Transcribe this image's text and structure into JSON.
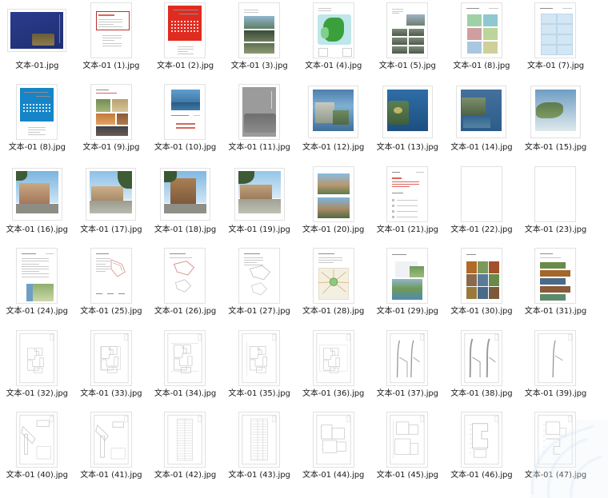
{
  "window": {
    "background_color": "#ffffff",
    "columns": 8,
    "rows": 6,
    "total_items": 48
  },
  "watermark": {
    "name": "corner-watermark",
    "color": "#cfe0ef",
    "visible": true
  },
  "files": [
    {
      "label": "文本-01.jpg",
      "kind": "cover-blue-landscape",
      "orient": "landscape"
    },
    {
      "label": "文本-01 (1).jpg",
      "kind": "doc-red-frame",
      "orient": "portrait"
    },
    {
      "label": "文本-01 (2).jpg",
      "kind": "cover-red",
      "orient": "portrait"
    },
    {
      "label": "文本-01 (3).jpg",
      "kind": "doc-photo-strip",
      "orient": "portrait"
    },
    {
      "label": "文本-01 (4).jpg",
      "kind": "map-green",
      "orient": "portrait"
    },
    {
      "label": "文本-01 (5).jpg",
      "kind": "doc-photo-grid-gray",
      "orient": "portrait"
    },
    {
      "label": "文本-01 (8).jpg",
      "kind": "doc-analysis-4up",
      "orient": "portrait"
    },
    {
      "label": "文本-01 (7).jpg",
      "kind": "doc-analysis-blue",
      "orient": "portrait"
    },
    {
      "label": "文本-01 (8).jpg",
      "kind": "cover-cyan",
      "orient": "portrait"
    },
    {
      "label": "文本-01 (9).jpg",
      "kind": "doc-collage-warm",
      "orient": "portrait"
    },
    {
      "label": "文本-01 (10).jpg",
      "kind": "doc-lake-photo",
      "orient": "portrait"
    },
    {
      "label": "文本-01 (11).jpg",
      "kind": "render-gray",
      "orient": "portrait"
    },
    {
      "label": "文本-01 (12).jpg",
      "kind": "render-aerial-city",
      "orient": "square"
    },
    {
      "label": "文本-01 (13).jpg",
      "kind": "render-aerial-bay",
      "orient": "square"
    },
    {
      "label": "文本-01 (14).jpg",
      "kind": "render-aerial-coast",
      "orient": "square"
    },
    {
      "label": "文本-01 (15).jpg",
      "kind": "render-aerial-river",
      "orient": "square"
    },
    {
      "label": "文本-01 (16).jpg",
      "kind": "render-villa-a",
      "orient": "square"
    },
    {
      "label": "文本-01 (17).jpg",
      "kind": "render-street-a",
      "orient": "square"
    },
    {
      "label": "文本-01 (18).jpg",
      "kind": "render-villa-b",
      "orient": "square"
    },
    {
      "label": "文本-01 (19).jpg",
      "kind": "render-street-b",
      "orient": "square"
    },
    {
      "label": "文本-01 (20).jpg",
      "kind": "render-two-up",
      "orient": "portrait"
    },
    {
      "label": "文本-01 (21).jpg",
      "kind": "doc-text-list",
      "orient": "portrait"
    },
    {
      "label": "文本-01 (22).jpg",
      "kind": "doc-photo-mosaic",
      "orient": "portrait"
    },
    {
      "label": "文本-01 (23).jpg",
      "kind": "cover-blue-page",
      "orient": "portrait"
    },
    {
      "label": "文本-01 (24).jpg",
      "kind": "doc-text-sitemap",
      "orient": "portrait"
    },
    {
      "label": "文本-01 (25).jpg",
      "kind": "doc-diagram-red",
      "orient": "portrait"
    },
    {
      "label": "文本-01 (26).jpg",
      "kind": "doc-diagram-red2",
      "orient": "portrait"
    },
    {
      "label": "文本-01 (27).jpg",
      "kind": "doc-diagram-gray",
      "orient": "portrait"
    },
    {
      "label": "文本-01 (28).jpg",
      "kind": "doc-radial-map",
      "orient": "portrait"
    },
    {
      "label": "文本-01 (29).jpg",
      "kind": "doc-landscape-plan",
      "orient": "portrait"
    },
    {
      "label": "文本-01 (30).jpg",
      "kind": "doc-mood-collage",
      "orient": "portrait"
    },
    {
      "label": "文本-01 (31).jpg",
      "kind": "doc-strip-collage",
      "orient": "portrait"
    },
    {
      "label": "文本-01 (32).jpg",
      "kind": "cad-plan-faint",
      "orient": "portrait"
    },
    {
      "label": "文本-01 (33).jpg",
      "kind": "cad-plan-b",
      "orient": "portrait"
    },
    {
      "label": "文本-01 (34).jpg",
      "kind": "cad-plan-c",
      "orient": "portrait"
    },
    {
      "label": "文本-01 (35).jpg",
      "kind": "cad-plan-d",
      "orient": "portrait"
    },
    {
      "label": "文本-01 (36).jpg",
      "kind": "cad-plan-e",
      "orient": "portrait"
    },
    {
      "label": "文本-01 (37).jpg",
      "kind": "cad-road-a",
      "orient": "portrait"
    },
    {
      "label": "文本-01 (38).jpg",
      "kind": "cad-road-b",
      "orient": "portrait"
    },
    {
      "label": "文本-01 (39).jpg",
      "kind": "cad-road-c",
      "orient": "portrait"
    },
    {
      "label": "文本-01 (40).jpg",
      "kind": "cad-diagonal-a",
      "orient": "portrait"
    },
    {
      "label": "文本-01 (41).jpg",
      "kind": "cad-diagonal-b",
      "orient": "portrait"
    },
    {
      "label": "文本-01 (42).jpg",
      "kind": "cad-table-a",
      "orient": "portrait"
    },
    {
      "label": "文本-01 (43).jpg",
      "kind": "cad-table-b",
      "orient": "portrait"
    },
    {
      "label": "文本-01 (44).jpg",
      "kind": "cad-floor-a",
      "orient": "portrait"
    },
    {
      "label": "文本-01 (45).jpg",
      "kind": "cad-floor-b",
      "orient": "portrait"
    },
    {
      "label": "文本-01 (46).jpg",
      "kind": "cad-floor-c",
      "orient": "portrait"
    },
    {
      "label": "文本-01 (47).jpg",
      "kind": "cad-floor-d",
      "orient": "portrait"
    }
  ]
}
